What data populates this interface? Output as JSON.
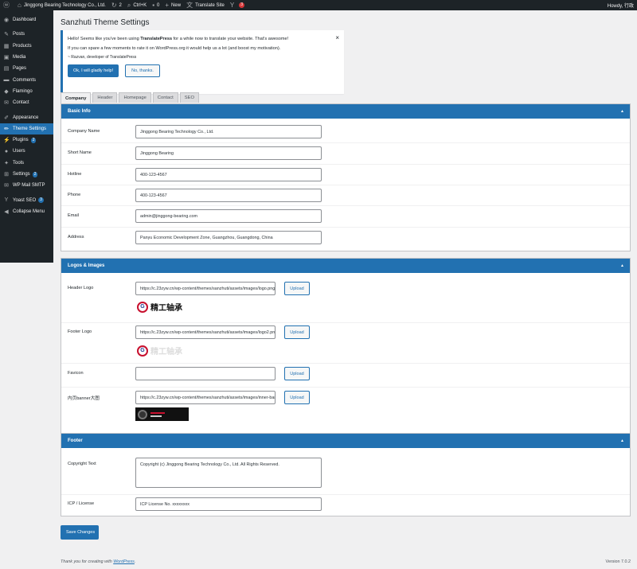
{
  "adminbar": {
    "site_name": "Jinggong Bearing Technology Co., Ltd.",
    "updates_count": "2",
    "shortcut": "Ctrl+K",
    "comments_count": "0",
    "new_label": "New",
    "translate_label": "Translate Site",
    "notifications_count": "3",
    "howdy": "Howdy, 行政"
  },
  "sidebar": {
    "items": [
      {
        "label": "Dashboard",
        "icon": "dashboard-icon"
      },
      {
        "label": "Posts",
        "icon": "pin-icon"
      },
      {
        "label": "Products",
        "icon": "grid-icon"
      },
      {
        "label": "Media",
        "icon": "media-icon"
      },
      {
        "label": "Pages",
        "icon": "page-icon"
      },
      {
        "label": "Comments",
        "icon": "comment-icon"
      },
      {
        "label": "Flamingo",
        "icon": "flamingo-icon"
      },
      {
        "label": "Contact",
        "icon": "mail-icon"
      },
      {
        "label": "Appearance",
        "icon": "brush-icon"
      },
      {
        "label": "Theme Settings",
        "icon": "pen-icon"
      },
      {
        "label": "Plugins",
        "icon": "plugin-icon",
        "badge": "2"
      },
      {
        "label": "Users",
        "icon": "user-icon"
      },
      {
        "label": "Tools",
        "icon": "wrench-icon"
      },
      {
        "label": "Settings",
        "icon": "settings-icon",
        "badge": "2"
      },
      {
        "label": "WP Mail SMTP",
        "icon": "smtp-icon"
      },
      {
        "label": "Yoast SEO",
        "icon": "yoast-icon",
        "badge": "3"
      },
      {
        "label": "Collapse Menu",
        "icon": "collapse-icon"
      }
    ]
  },
  "page": {
    "title": "Sanzhuti Theme Settings"
  },
  "notice": {
    "line1_pre": "Hello! Seems like you've been using ",
    "line1_bold": "TranslatePress",
    "line1_post": " for a while now to translate your website. That's awesome!",
    "line2": "If you can spare a few moments to rate it on WordPress.org it would help us a lot (and boost my motivation).",
    "signature": "~ Razvan, developer of TranslatePress",
    "primary_btn": "Ok, I will gladly help!",
    "secondary_btn": "No, thanks.",
    "close": "×"
  },
  "tabs": [
    "Company",
    "Header",
    "Homepage",
    "Contact",
    "SEO"
  ],
  "sections": {
    "basic": {
      "title": "Basic Info",
      "toggle": "▲",
      "fields": [
        {
          "label": "Company Name",
          "value": "Jinggong Bearing Technology Co., Ltd."
        },
        {
          "label": "Short Name",
          "value": "Jinggong Bearing"
        },
        {
          "label": "Hotline",
          "value": "400-123-4567"
        },
        {
          "label": "Phone",
          "value": "400-123-4567"
        },
        {
          "label": "Email",
          "value": "admin@jinggong-bearing.com"
        },
        {
          "label": "Address",
          "value": "Panyu Economic Development Zone, Guangzhou, Guangdong, China"
        }
      ]
    },
    "logos": {
      "title": "Logos & Images",
      "toggle": "▲",
      "upload_label": "Upload",
      "logo_text": "精工轴承",
      "fields": [
        {
          "label": "Header Logo",
          "value": "https://c.23zyw.cn/wp-content/themes/sanzhuti/assets/images/logo.png"
        },
        {
          "label": "Footer Logo",
          "value": "https://c.23zyw.cn/wp-content/themes/sanzhuti/assets/images/logo2.png"
        },
        {
          "label": "Favicon",
          "value": ""
        },
        {
          "label": "内页banner大图",
          "value": "https://c.23zyw.cn/wp-content/themes/sanzhuti/assets/images/inner-banner.jpg"
        }
      ]
    },
    "footer": {
      "title": "Footer",
      "toggle": "▲",
      "fields": [
        {
          "label": "Copyright Text",
          "value": "Copyright (c) Jinggong Bearing Technology Co., Ltd. All Rights Reserved."
        },
        {
          "label": "ICP / License",
          "value": "ICP License No. xxxxxxxx"
        }
      ]
    }
  },
  "save_button": "Save Changes",
  "footer": {
    "thanks_pre": "Thank you for creating with ",
    "thanks_link": "WordPress",
    "thanks_post": ".",
    "version": "Version 7.0.2"
  },
  "colors": {
    "accent": "#2271b1",
    "adminbar": "#1d2327",
    "badge_red": "#d63638"
  }
}
